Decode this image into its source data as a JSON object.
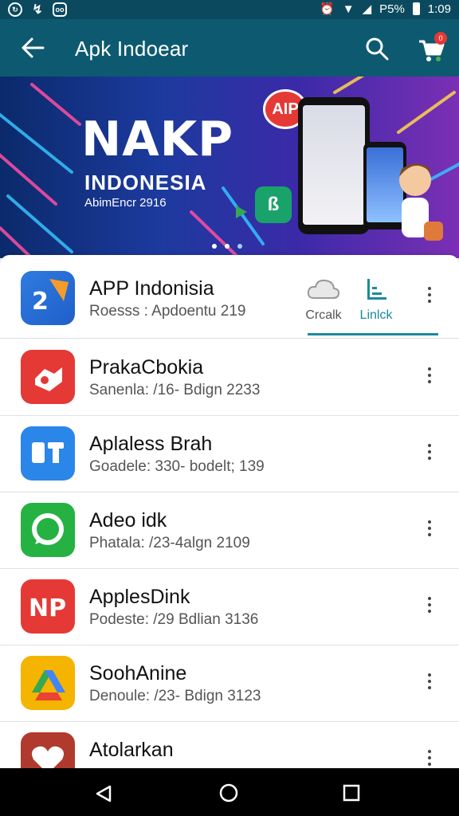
{
  "status_bar": {
    "battery_text": "P5%",
    "time": "1:09"
  },
  "app_bar": {
    "title": "Apk Indoear",
    "icons": [
      "back-arrow-icon",
      "search-icon",
      "cart-icon"
    ]
  },
  "banner": {
    "title": "NAKP",
    "subtitle": "INDONESIA",
    "small_text": "AbimEncr 2916",
    "badge": "AIP",
    "page_count": 3,
    "active_page": 3
  },
  "featured": {
    "name": "APP Indonisia",
    "meta": "Roesss : Apdoentu 219",
    "action_left": "Crcalk",
    "action_right": "Linlck",
    "colors": {
      "accent": "#1a8aa0"
    }
  },
  "apps": [
    {
      "name": "PrakaCbokia",
      "meta": "Sanenla: /16- Bdign 2233",
      "icon_color": "#e53935",
      "icon": "handshake-icon"
    },
    {
      "name": "Aplaless Brah",
      "meta": "Goadele: 330- bodelt; 139",
      "icon_color": "#2a86e8",
      "icon": "puzzle-icon"
    },
    {
      "name": "Adeo idk",
      "meta": "Phatala: /23-4algn 2109",
      "icon_color": "#25b243",
      "icon": "chat-bubble-icon"
    },
    {
      "name": "ApplesDink",
      "meta": "Podeste: /29 Bdlian 3136",
      "icon_color": "#e53935",
      "icon": "np-logo-icon"
    },
    {
      "name": "SoohAnine",
      "meta": "Denoule: /23- Bdign 3123",
      "icon_color": "#f4b400",
      "icon": "drive-triangle-icon"
    },
    {
      "name": "Atolarkan",
      "meta": "",
      "icon_color": "#b03a2e",
      "icon": "heart-app-icon"
    }
  ],
  "nav_bar": {
    "buttons": [
      "back-triangle-icon",
      "home-circle-icon",
      "recents-square-icon"
    ]
  }
}
